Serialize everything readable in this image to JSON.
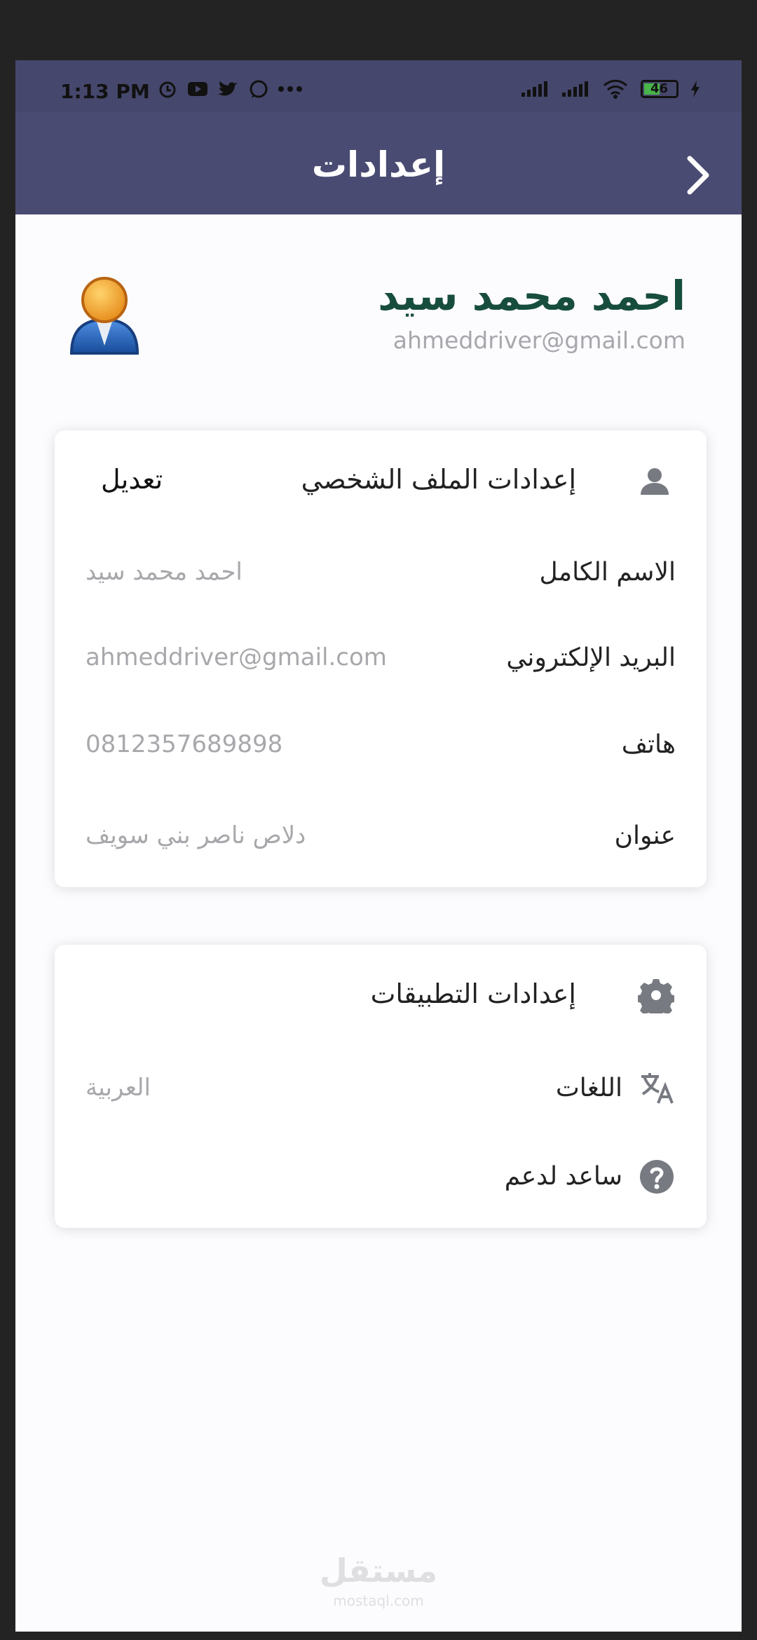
{
  "status": {
    "time": "1:13 PM",
    "battery": "46"
  },
  "header": {
    "title": "إعدادات",
    "back_icon": "chevron-right-icon"
  },
  "profile": {
    "name": "احمد محمد سيد",
    "email": "ahmeddriver@gmail.com",
    "avatar_icon": "user-avatar-icon"
  },
  "profile_settings": {
    "title": "إعدادات الملف الشخصي",
    "edit_label": "تعديل",
    "icon": "person-icon",
    "fields": [
      {
        "label": "الاسم الكامل",
        "value": "احمد محمد سيد"
      },
      {
        "label": "البريد الإلكتروني",
        "value": "ahmeddriver@gmail.com"
      },
      {
        "label": "هاتف",
        "value": "0812357689898"
      },
      {
        "label": "عنوان",
        "value": "دلاص ناصر بني سويف"
      }
    ]
  },
  "app_settings": {
    "title": "إعدادات التطبيقات",
    "icon": "gear-icon",
    "language_label": "اللغات",
    "language_value": "العربية",
    "language_icon": "translate-icon",
    "help_label": "ساعد لدعم",
    "help_icon": "help-icon"
  },
  "watermark": {
    "arabic": "مستقل",
    "latin": "mostaql.com"
  },
  "colors": {
    "appbar": "#4a4b72",
    "statusbar": "#46476c",
    "name": "#174d3d",
    "muted": "#a8a8ac",
    "icon": "#777a80"
  }
}
